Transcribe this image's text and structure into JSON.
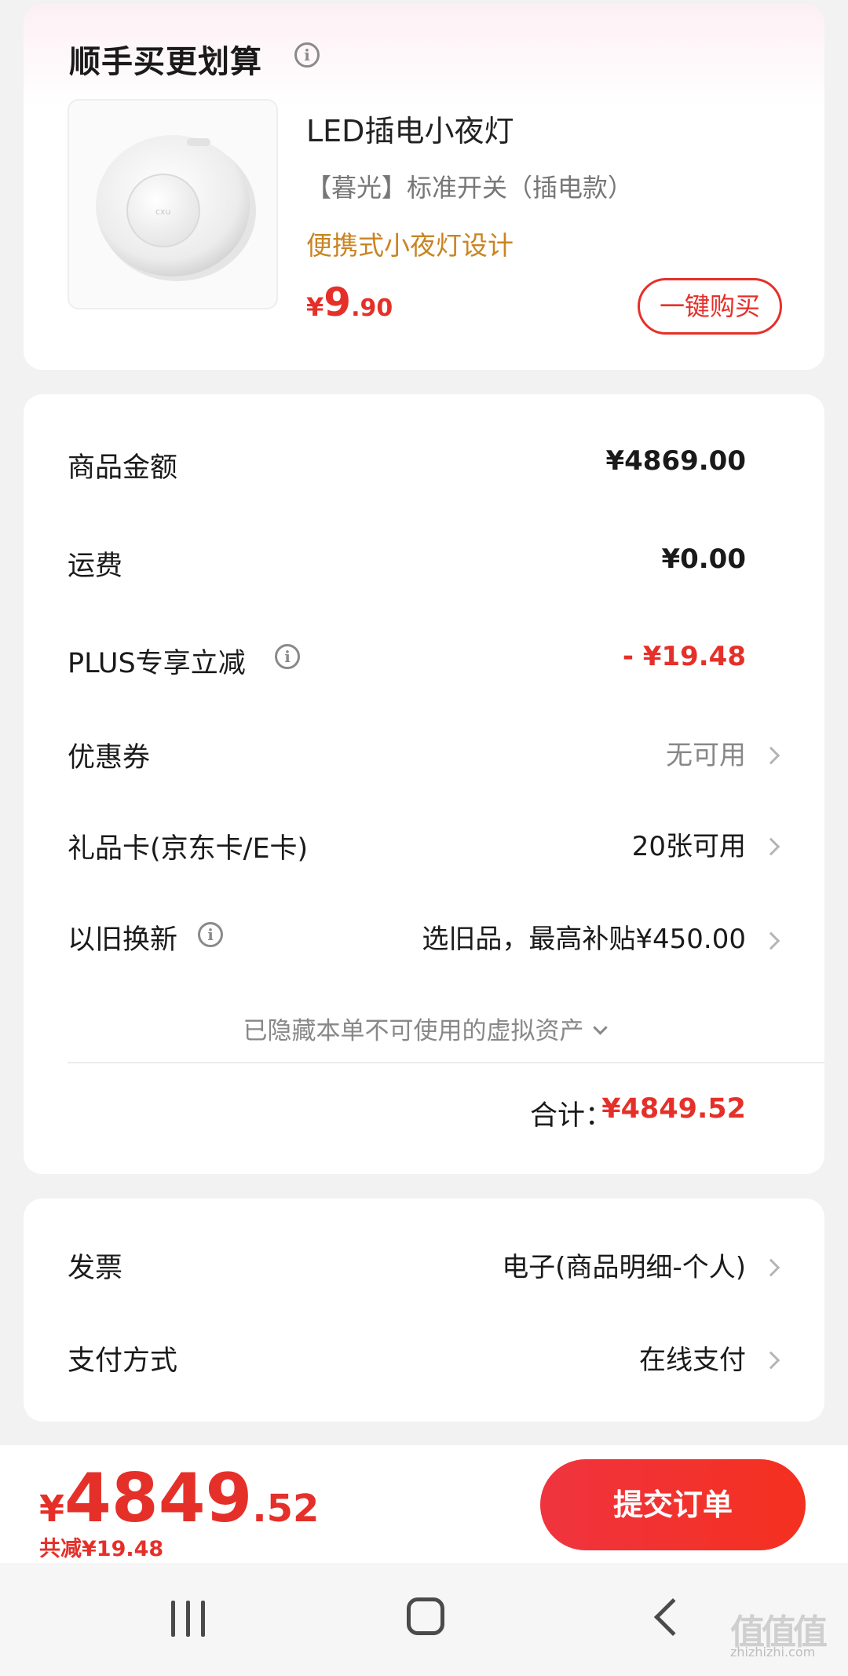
{
  "recommend": {
    "title": "顺手买更划算",
    "product": {
      "name": "LED插电小夜灯",
      "spec": "【暮光】标准开关（插电款）",
      "promo": "便携式小夜灯设计",
      "price_symbol": "¥",
      "price_int": "9",
      "price_dec": ".90",
      "buy_label": "一键购买"
    }
  },
  "summary": {
    "rows": [
      {
        "label": "商品金额",
        "value": "¥4869.00"
      },
      {
        "label": "运费",
        "value": "¥0.00"
      },
      {
        "label": "PLUS专享立减",
        "value": "- ¥19.48"
      },
      {
        "label": "优惠券",
        "value": "无可用"
      },
      {
        "label": "礼品卡(京东卡/E卡)",
        "value": "20张可用"
      },
      {
        "label": "以旧换新",
        "value": "选旧品，最高补贴¥450.00"
      }
    ],
    "hidden_note": "已隐藏本单不可使用的虚拟资产",
    "total_label": "合计：",
    "total_value": "¥4849.52"
  },
  "invoice": {
    "rows": [
      {
        "label": "发票",
        "value": "电子(商品明细-个人)"
      },
      {
        "label": "支付方式",
        "value": "在线支付"
      }
    ]
  },
  "bottom_bar": {
    "price_symbol": "¥",
    "price_int": "4849",
    "price_dec": ".52",
    "saving": "共减¥19.48",
    "submit_label": "提交订单"
  },
  "watermark": {
    "logo": "值值值",
    "url": "zhizhizhi.com"
  },
  "colors": {
    "accent_red": "#e5302a",
    "promo_gold": "#c98422",
    "muted_gray": "#888888"
  }
}
